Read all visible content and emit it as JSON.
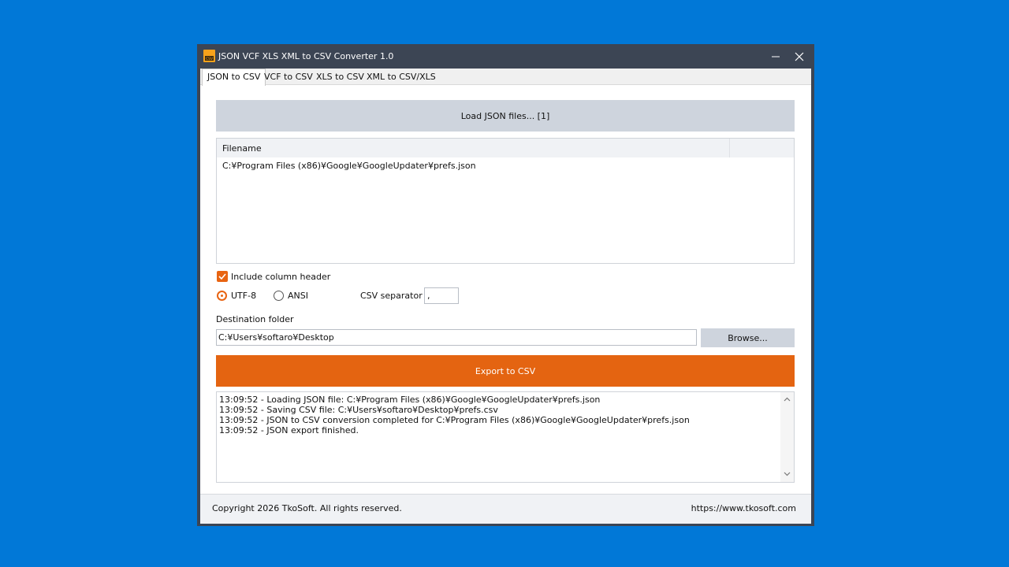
{
  "window": {
    "title": "JSON VCF XLS XML to CSV Converter 1.0",
    "minimize_icon": "minimize-icon",
    "close_icon": "close-icon"
  },
  "tabs": [
    {
      "label": "JSON to CSV",
      "active": true
    },
    {
      "label": "VCF to CSV",
      "active": false
    },
    {
      "label": "XLS to CSV",
      "active": false
    },
    {
      "label": "XML to CSV/XLS",
      "active": false
    }
  ],
  "load_button": "Load JSON files... [1]",
  "file_list": {
    "column_header": "Filename",
    "rows": [
      "C:¥Program Files (x86)¥Google¥GoogleUpdater¥prefs.json"
    ]
  },
  "options": {
    "include_header_label": "Include column header",
    "include_header_checked": true,
    "encoding": {
      "utf8_label": "UTF-8",
      "ansi_label": "ANSI",
      "selected": "UTF-8"
    },
    "separator_label": "CSV separator",
    "separator_value": ","
  },
  "destination": {
    "label": "Destination folder",
    "value": "C:¥Users¥softaro¥Desktop",
    "browse_label": "Browse..."
  },
  "export_button": "Export to CSV",
  "log": [
    "13:09:52 - Loading JSON file: C:¥Program Files (x86)¥Google¥GoogleUpdater¥prefs.json",
    "13:09:52 - Saving CSV file: C:¥Users¥softaro¥Desktop¥prefs.csv",
    "13:09:52 - JSON to CSV conversion completed for C:¥Program Files (x86)¥Google¥GoogleUpdater¥prefs.json",
    "13:09:52 - JSON export finished."
  ],
  "footer": {
    "copyright": "Copyright 2026 TkoSoft. All rights reserved.",
    "url": "https://www.tkosoft.com"
  },
  "colors": {
    "desktop": "#0178d7",
    "titlebar": "#3c4554",
    "accent": "#e46411",
    "button": "#ced4dd"
  }
}
